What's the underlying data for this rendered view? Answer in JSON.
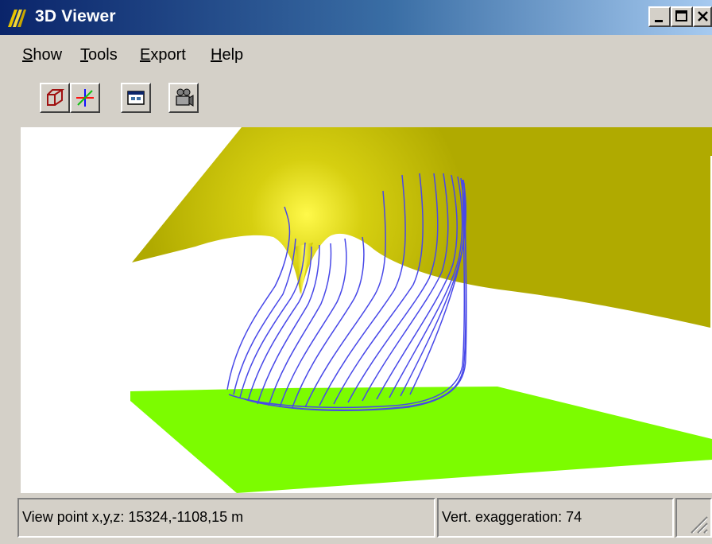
{
  "window": {
    "title": "3D Viewer",
    "controls": [
      "minimize",
      "maximize",
      "close"
    ],
    "title_gradient": [
      "#0a246a",
      "#a6caf0"
    ]
  },
  "menu": {
    "items": [
      {
        "label": "Show",
        "mnemonic": "S"
      },
      {
        "label": "Tools",
        "mnemonic": "T"
      },
      {
        "label": "Export",
        "mnemonic": "E"
      },
      {
        "label": "Help",
        "mnemonic": "H"
      }
    ]
  },
  "toolbar": {
    "buttons": [
      {
        "icon": "box-wireframe-icon"
      },
      {
        "icon": "axes-icon"
      },
      {
        "icon": "window-icon"
      },
      {
        "icon": "camera-icon"
      }
    ]
  },
  "scene": {
    "upper_surface_color": "#b5b000",
    "upper_surface_highlight": "#fff94a",
    "lower_surface_color": "#7cfc00",
    "curves_color": "#4040e0",
    "background": "#ffffff"
  },
  "status": {
    "viewpoint": "View point x,y,z: 15324,-1108,15 m",
    "exaggeration": "Vert. exaggeration: 74"
  }
}
